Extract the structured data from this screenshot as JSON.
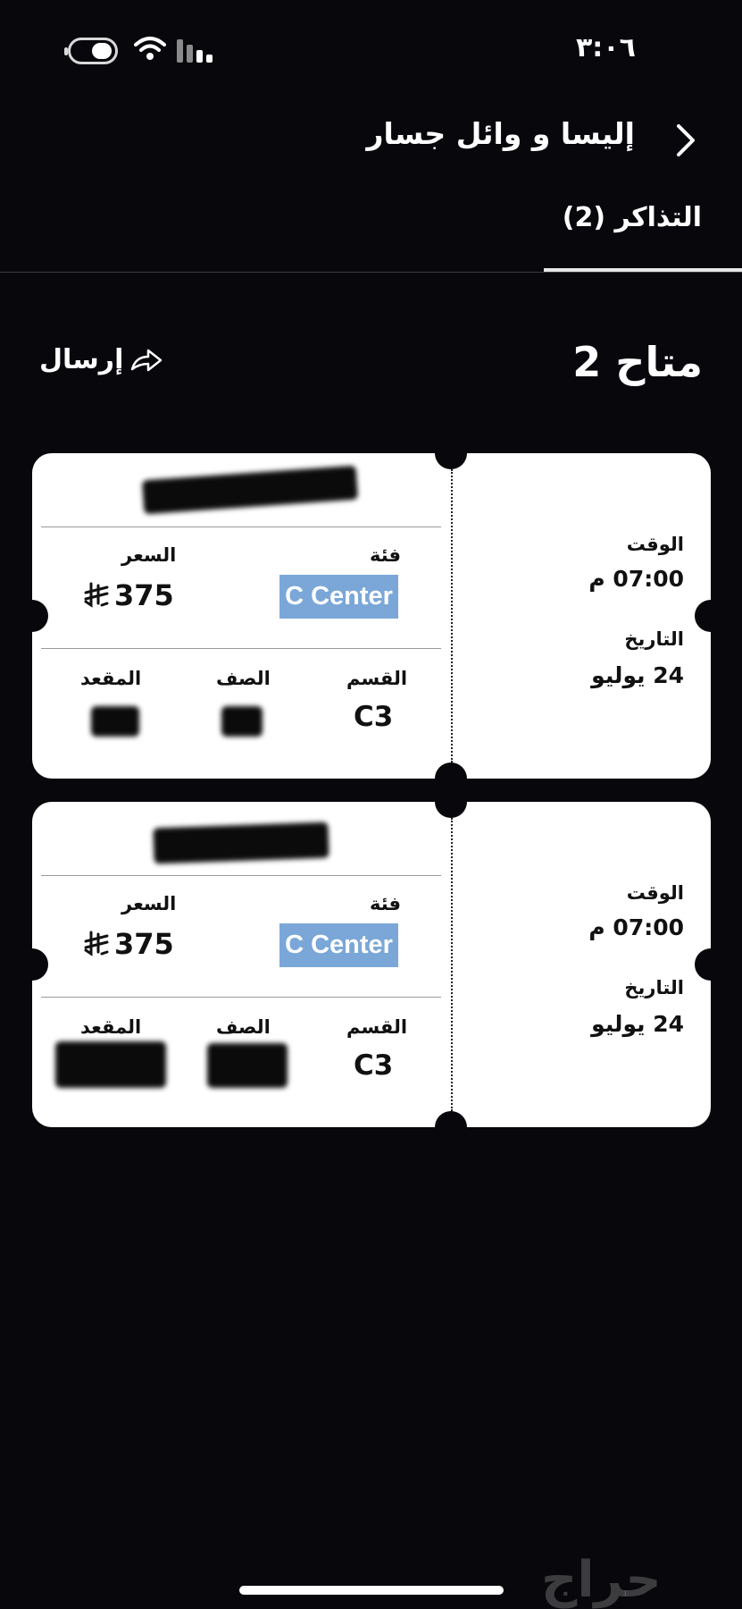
{
  "status_bar": {
    "time": "٣:٠٦"
  },
  "header": {
    "title": "إليسا و وائل جسار",
    "tab_label": "التذاكر (2)"
  },
  "summary": {
    "available_label": "متاح 2",
    "send_label": "إرسال"
  },
  "tickets": [
    {
      "time_label": "الوقت",
      "time": "07:00 م",
      "date_label": "التاريخ",
      "date": "24 يوليو",
      "category_label": "فئة",
      "category": "C Center",
      "price_label": "السعر",
      "price": "375",
      "section_label": "القسم",
      "section": "C3",
      "row_label": "الصف",
      "seat_label": "المقعد"
    },
    {
      "time_label": "الوقت",
      "time": "07:00 م",
      "date_label": "التاريخ",
      "date": "24 يوليو",
      "category_label": "فئة",
      "category": "C Center",
      "price_label": "السعر",
      "price": "375",
      "section_label": "القسم",
      "section": "C3",
      "row_label": "الصف",
      "seat_label": "المقعد"
    }
  ],
  "watermark": "حراج",
  "colors": {
    "background": "#07070c",
    "ticket": "#ffffff",
    "category_highlight": "#7aa7d8"
  },
  "icons": [
    "battery-icon",
    "wifi-icon",
    "signal-icon",
    "chevron-back-icon",
    "share-icon",
    "riyal-icon"
  ]
}
